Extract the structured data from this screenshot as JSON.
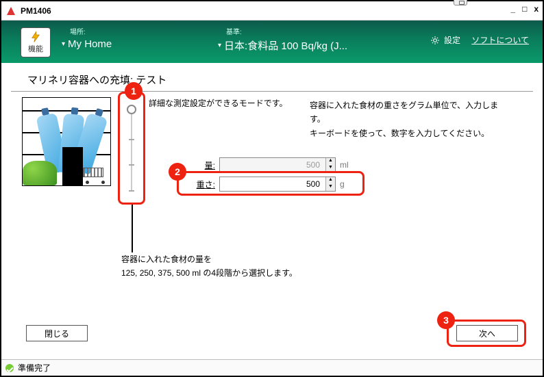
{
  "window": {
    "title": "PM1406"
  },
  "titlebar_buttons": {
    "min": "_",
    "max": "□",
    "close": "x"
  },
  "header": {
    "func_button": "機能",
    "location_label": "場所:",
    "location_value": "My Home",
    "criteria_label": "基準:",
    "criteria_value": "日本:食料品 100 Bq/kg (J...",
    "settings": "設定",
    "about": "ソフトについて"
  },
  "section_title": "マリネリ容器への充填: テスト",
  "mode_desc": "詳細な測定設定ができるモードです。",
  "top_desc_line1": "容器に入れた食材の重さをグラム単位で、入力します。",
  "top_desc_line2": "キーボードを使って、数字を入力してください。",
  "volume": {
    "label": "量:",
    "value": "500",
    "unit": "ml"
  },
  "weight": {
    "label": "重さ:",
    "value": "500",
    "unit": "g"
  },
  "slider_note_line1": "容器に入れた食材の量を",
  "slider_note_line2": "125, 250, 375, 500 ml の4段階から選択します。",
  "buttons": {
    "close": "閉じる",
    "next": "次へ"
  },
  "status": "準備完了",
  "callouts": {
    "one": "1",
    "two": "2",
    "three": "3"
  },
  "slider": {
    "options_ml": [
      500,
      375,
      250,
      125
    ],
    "selected_ml": 500
  }
}
